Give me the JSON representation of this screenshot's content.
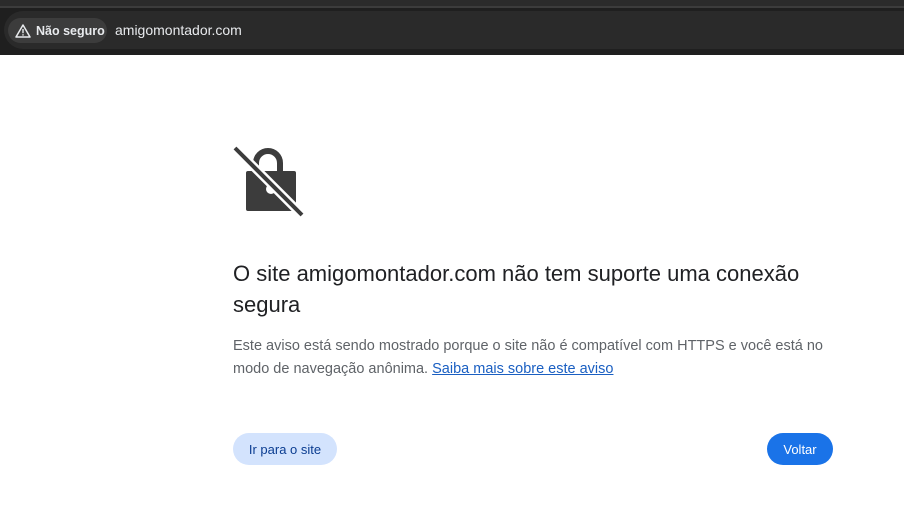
{
  "toolbar": {
    "security_label": "Não seguro",
    "url": "amigomontador.com"
  },
  "interstitial": {
    "title": "O site amigomontador.com não tem suporte uma conexão segura",
    "message": "Este aviso está sendo mostrado porque o site não é compatível com HTTPS e você está no modo de navegação anônima.",
    "learn_more_link": "Saiba mais sobre este aviso",
    "proceed_button": "Ir para o site",
    "back_button": "Voltar"
  },
  "icons": {
    "security_chip": "warning-icon",
    "header": "lock-off-icon"
  },
  "colors": {
    "primary_button": "#1a73e8",
    "secondary_button": "#d3e3fd",
    "link": "#1a5fc2"
  }
}
